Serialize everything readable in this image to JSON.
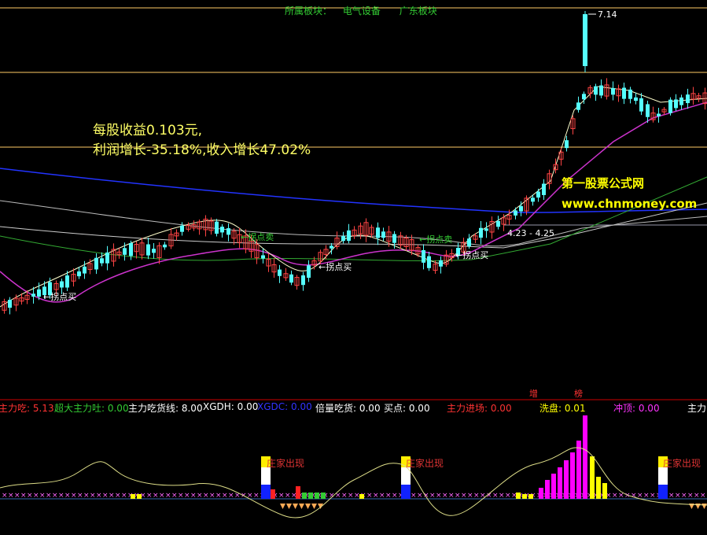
{
  "header": {
    "sector_label": "所属板块：",
    "sector_1": "电气设备",
    "sector_2": "广东板块"
  },
  "fundamentals": {
    "eps_line": "每股收益0.103元,",
    "growth_line": "利润增长-35.18%,收入增长47.02%"
  },
  "watermark": {
    "cn": "第一股票公式网",
    "url": "www.chnmoney.com"
  },
  "price_marks": {
    "high_label": "7.14",
    "range_label": "4.23 - 4.25"
  },
  "signals": [
    {
      "text": "拐点买",
      "color": "#ffffff"
    },
    {
      "text": "拐点卖",
      "color": "#33cc33"
    },
    {
      "text": "拐点买",
      "color": "#ffffff"
    },
    {
      "text": "拐点卖",
      "color": "#33cc33"
    },
    {
      "text": "拐点买",
      "color": "#ffffff"
    }
  ],
  "bank_tags": {
    "left": "增",
    "right": "榜"
  },
  "indicator": [
    {
      "label": "主力吃: 5.13",
      "color": "#ff3333"
    },
    {
      "label": "超大主力吐: 0.00",
      "color": "#33cc33"
    },
    {
      "label": "主力吃货线: 8.00",
      "color": "#ffffff"
    },
    {
      "label": "XGDH: 0.00",
      "color": "#ffffff"
    },
    {
      "label": "XGDC: 0.00",
      "color": "#3333ff"
    },
    {
      "label": "倍量吃货: 0.00",
      "color": "#ffffff"
    },
    {
      "label": "买点: 0.00",
      "color": "#ffffff"
    },
    {
      "label": "主力进场: 0.00",
      "color": "#ff3333"
    },
    {
      "label": "洗盘: 0.01",
      "color": "#ffff00"
    },
    {
      "label": "冲顶: 0.00",
      "color": "#ff33ff"
    },
    {
      "label": "主力",
      "color": "#ffffff"
    }
  ],
  "dealer_tag": "庄家出现",
  "colors": {
    "up": "#ff4444",
    "down": "#55ffff",
    "ma_long": "#2233ff",
    "ma_purple": "#cc33cc",
    "ma_green": "#33aa33",
    "hline": "#ffcc66",
    "volume": "#ff00ff",
    "wash": "#ffff00",
    "divider": "#cc0000"
  }
}
